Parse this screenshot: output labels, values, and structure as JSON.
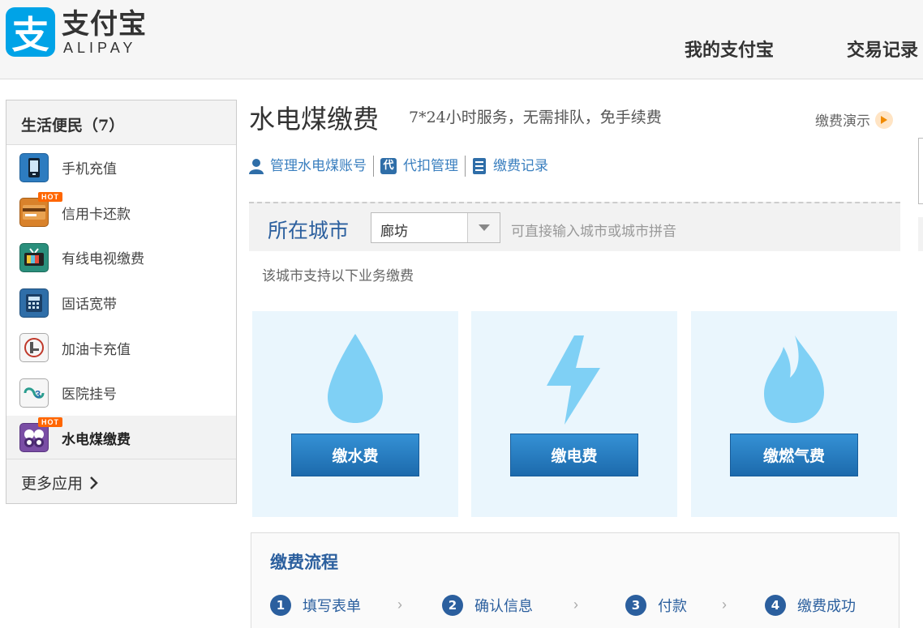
{
  "header": {
    "logo_mark": "支",
    "logo_cn": "支付宝",
    "logo_en": "ALIPAY",
    "nav": [
      "我的支付宝",
      "交易记录"
    ]
  },
  "sidebar": {
    "title": "生活便民（7）",
    "items": [
      {
        "label": "手机充值",
        "icon": "mobile-phone-icon",
        "hot": false
      },
      {
        "label": "信用卡还款",
        "icon": "credit-card-icon",
        "hot": true
      },
      {
        "label": "有线电视缴费",
        "icon": "tv-icon",
        "hot": false
      },
      {
        "label": "固话宽带",
        "icon": "landline-phone-icon",
        "hot": false
      },
      {
        "label": "加油卡充值",
        "icon": "fuel-card-icon",
        "hot": false
      },
      {
        "label": "医院挂号",
        "icon": "hospital-icon",
        "hot": false
      },
      {
        "label": "水电煤缴费",
        "icon": "utilities-icon",
        "hot": true,
        "active": true
      }
    ],
    "hot_badge": "HOT",
    "more": "更多应用"
  },
  "main": {
    "title": "水电煤缴费",
    "subtitle": "7*24小时服务，无需排队，免手续费",
    "demo": "缴费演示",
    "links": [
      {
        "label": "管理水电煤账号",
        "icon": "user-icon"
      },
      {
        "label": "代扣管理",
        "icon": "proxy-icon",
        "icon_text": "代"
      },
      {
        "label": "缴费记录",
        "icon": "record-icon"
      }
    ],
    "city": {
      "label": "所在城市",
      "value": "廊坊",
      "hint": "可直接输入城市或城市拼音"
    },
    "support_text": "该城市支持以下业务缴费",
    "services": [
      {
        "label": "缴水费",
        "icon": "water-drop-icon"
      },
      {
        "label": "缴电费",
        "icon": "lightning-icon"
      },
      {
        "label": "缴燃气费",
        "icon": "flame-icon"
      }
    ],
    "flow": {
      "title": "缴费流程",
      "steps": [
        {
          "num": "1",
          "label": "填写表单"
        },
        {
          "num": "2",
          "label": "确认信息"
        },
        {
          "num": "3",
          "label": "付款"
        },
        {
          "num": "4",
          "label": "缴费成功"
        }
      ],
      "separator": "›"
    }
  },
  "colors": {
    "brand": "#00a3e7",
    "link": "#3a7fbf",
    "title_blue": "#2b5f9e",
    "button": "#2278bd",
    "card_bg": "#eaf6fd",
    "icon_blue": "#7fd0f5",
    "hot": "#ff6600"
  }
}
